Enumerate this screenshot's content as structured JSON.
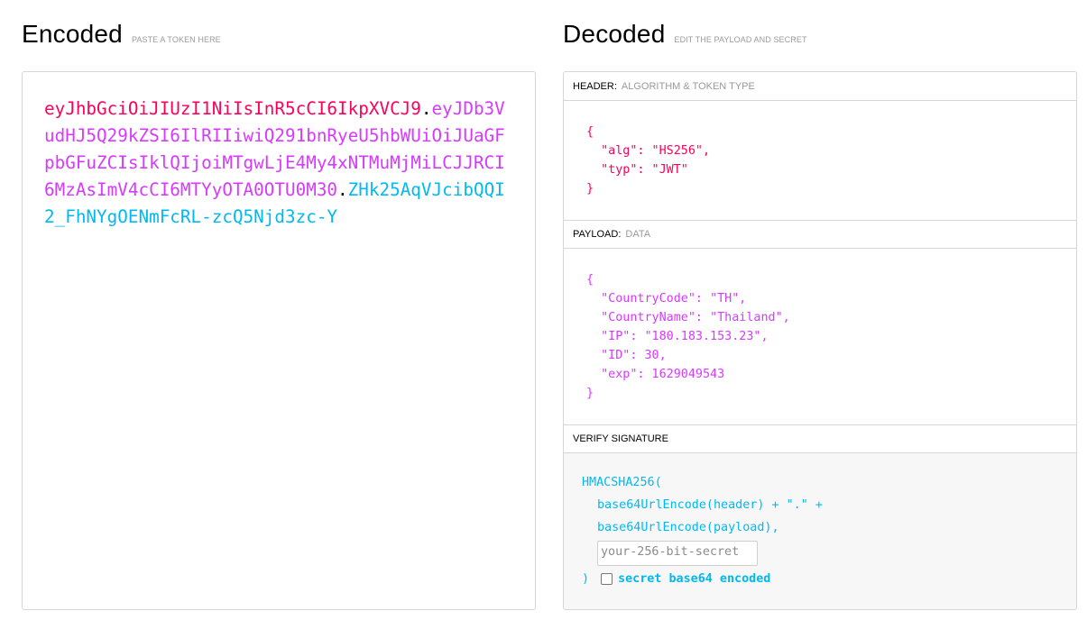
{
  "encoded": {
    "title": "Encoded",
    "subtitle": "PASTE A TOKEN HERE",
    "token": {
      "header": "eyJhbGciOiJIUzI1NiIsInR5cCI6IkpXVCJ9",
      "payload": "eyJDb3VudHJ5Q29kZSI6IlRIIiwiQ291bnRyeU5hbWUiOiJUaGFpbGFuZCIsIklQIjoiMTgwLjE4My4xNTMuMjMiLCJJRCI6MzAsImV4cCI6MTYyOTA0OTU0M30",
      "signature": "ZHk25AqVJcibQQI2_FhNYgOENmFcRL-zcQ5Njd3zc-Y",
      "dot": "."
    }
  },
  "decoded": {
    "title": "Decoded",
    "subtitle": "EDIT THE PAYLOAD AND SECRET",
    "header_section": {
      "label": "HEADER:",
      "sublabel": "ALGORITHM & TOKEN TYPE",
      "json": "{\n  \"alg\": \"HS256\",\n  \"typ\": \"JWT\"\n}"
    },
    "payload_section": {
      "label": "PAYLOAD:",
      "sublabel": "DATA",
      "json": "{\n  \"CountryCode\": \"TH\",\n  \"CountryName\": \"Thailand\",\n  \"IP\": \"180.183.153.23\",\n  \"ID\": 30,\n  \"exp\": 1629049543\n}"
    },
    "verify_section": {
      "label": "VERIFY SIGNATURE",
      "fn_open": "HMACSHA256(",
      "line1": "base64UrlEncode(header) + \".\" +",
      "line2": "base64UrlEncode(payload),",
      "secret_placeholder": "your-256-bit-secret",
      "fn_close": ")",
      "checkbox_label": "secret base64 encoded",
      "checkbox_checked": false
    }
  },
  "colors": {
    "header": "#fb015b",
    "payload": "#d63aff",
    "signature": "#00b9f1"
  }
}
